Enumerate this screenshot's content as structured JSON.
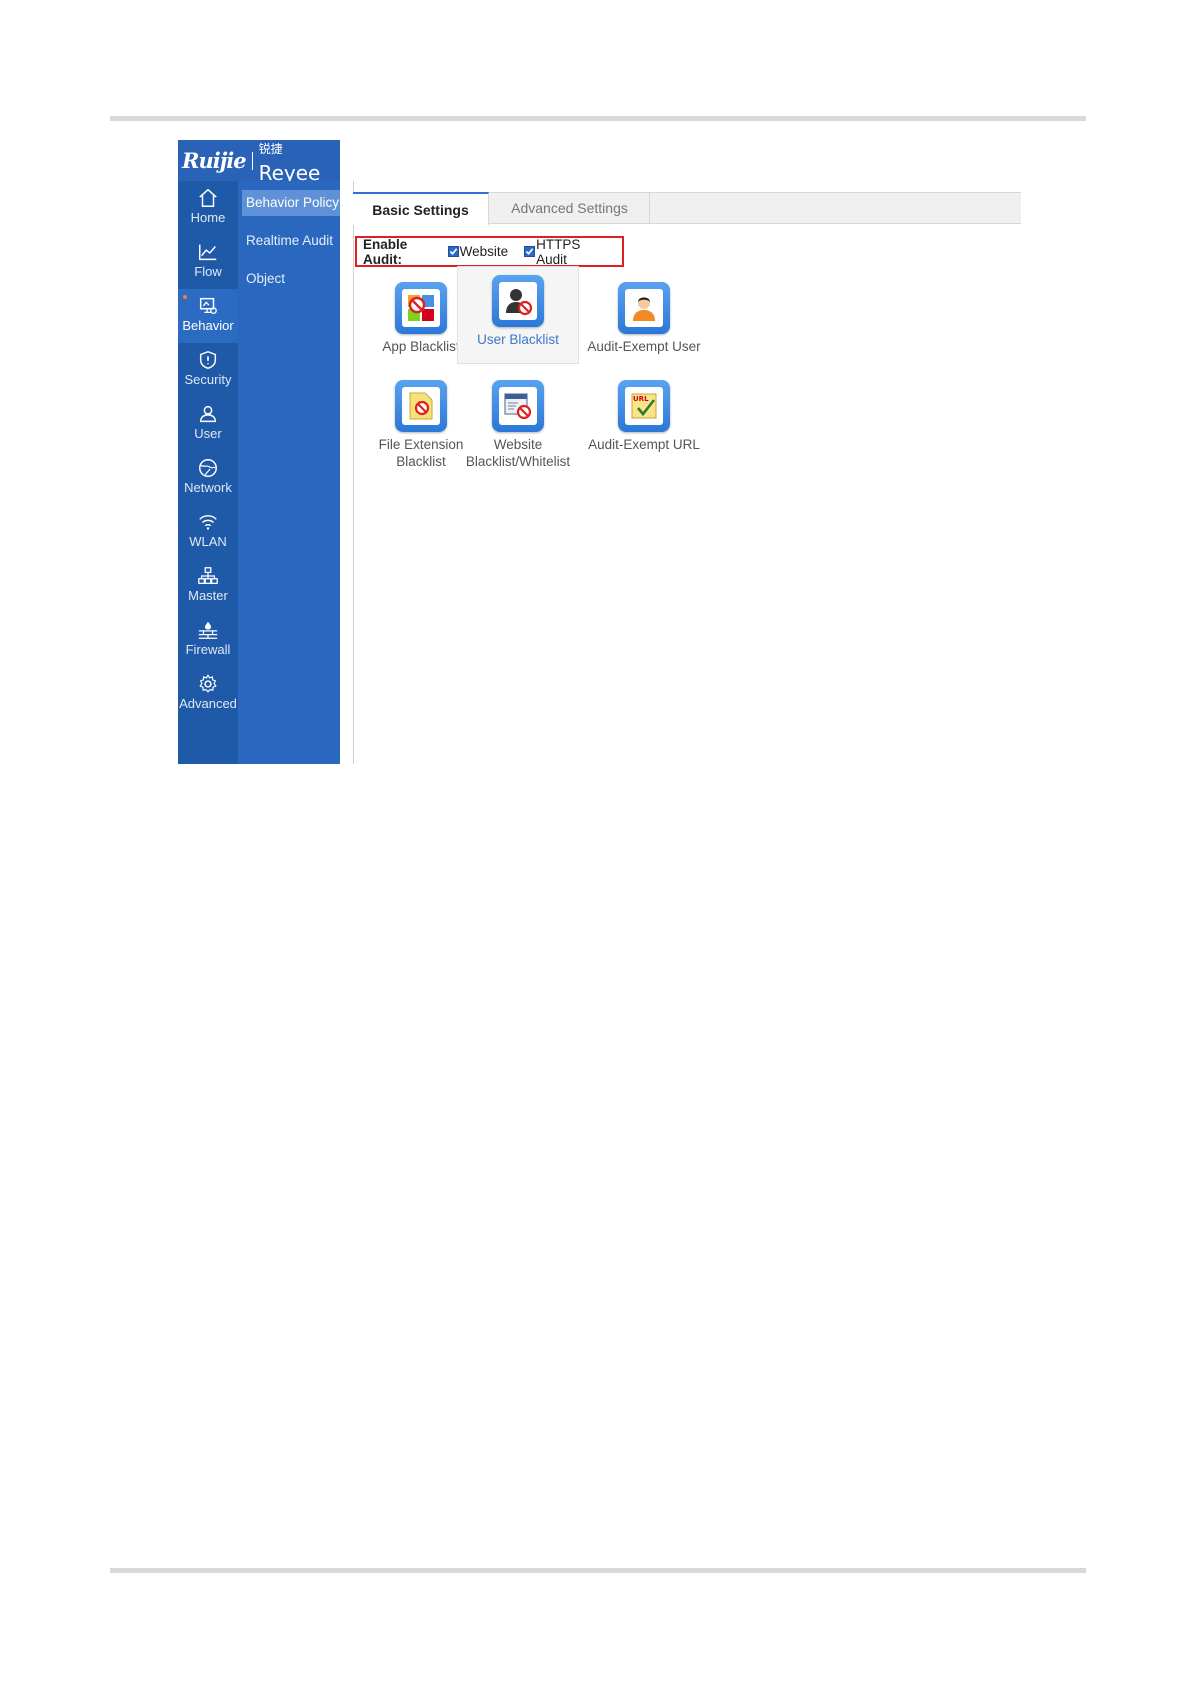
{
  "brand": {
    "logo_left": "Ruijie",
    "logo_right": "Reyee",
    "logo_mark": "锐捷"
  },
  "nav": {
    "items": [
      {
        "label": "Home",
        "icon": "home-icon"
      },
      {
        "label": "Flow",
        "icon": "chart-line-icon"
      },
      {
        "label": "Behavior",
        "icon": "monitor-icon"
      },
      {
        "label": "Security",
        "icon": "shield-icon"
      },
      {
        "label": "User",
        "icon": "user-icon"
      },
      {
        "label": "Network",
        "icon": "globe-icon"
      },
      {
        "label": "WLAN",
        "icon": "wifi-icon"
      },
      {
        "label": "Master",
        "icon": "topology-icon"
      },
      {
        "label": "Firewall",
        "icon": "firewall-icon"
      },
      {
        "label": "Advanced",
        "icon": "gear-icon"
      }
    ],
    "active": "Behavior"
  },
  "subnav": {
    "items": [
      "Behavior Policy",
      "Realtime Audit",
      "Object"
    ],
    "active": "Behavior Policy"
  },
  "tabs": {
    "basic": "Basic Settings",
    "advanced": "Advanced Settings",
    "active": "Basic Settings"
  },
  "audit": {
    "label": "Enable Audit:",
    "website": {
      "label": "Website",
      "checked": true
    },
    "https": {
      "label": "HTTPS Audit",
      "checked": true
    }
  },
  "tiles": {
    "app_blacklist": {
      "label": "App Blacklist"
    },
    "user_blacklist": {
      "label": "User Blacklist",
      "selected": true
    },
    "audit_exempt_user": {
      "label": "Audit-Exempt User"
    },
    "file_ext_blacklist": {
      "line1": "File Extension",
      "line2": "Blacklist"
    },
    "website_blacklist": {
      "line1": "Website",
      "line2": "Blacklist/Whitelist"
    },
    "audit_exempt_url": {
      "label": "Audit-Exempt URL",
      "icon_text": "URL"
    }
  },
  "colors": {
    "sidebar": "#1f5aa8",
    "subnav": "#2a67bf",
    "accent": "#2e6fd0",
    "highlight_box": "#e02020"
  }
}
